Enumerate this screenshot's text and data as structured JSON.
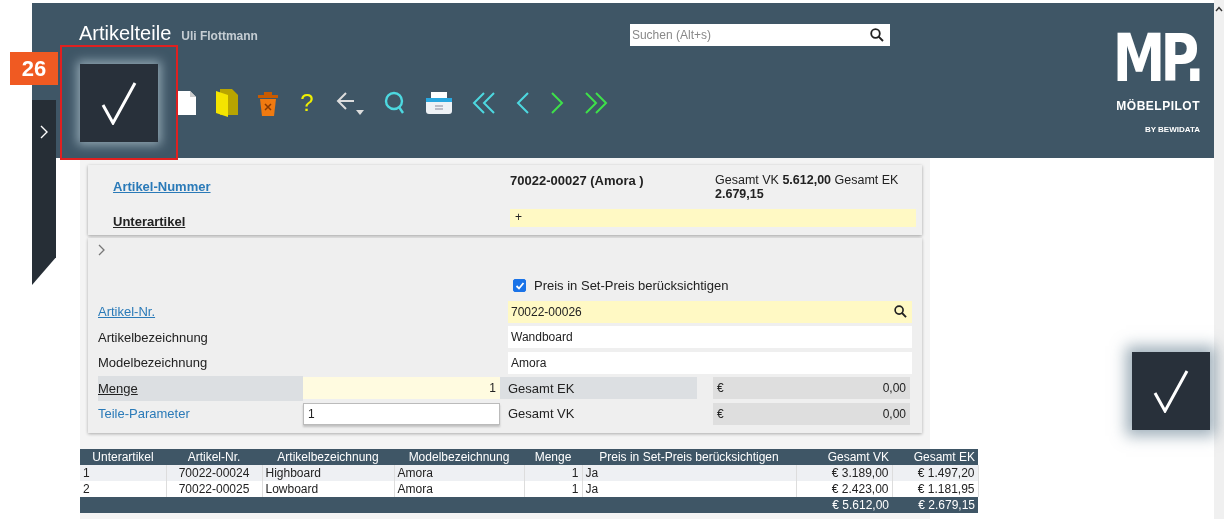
{
  "step_badge": "26",
  "header": {
    "title": "Artikelteile",
    "user": "Uli Flottmann",
    "search": {
      "placeholder": "Suchen (Alt+s)"
    },
    "logo": {
      "wordmark": "MP.",
      "name": "MÖBELPILOT",
      "tagline": "BY BEWIDATA"
    }
  },
  "toolbar": [
    {
      "kind": "confirm"
    },
    {
      "kind": "new"
    },
    {
      "kind": "open"
    },
    {
      "kind": "delete"
    },
    {
      "kind": "help",
      "glyph": "?"
    },
    {
      "kind": "back"
    },
    {
      "kind": "search"
    },
    {
      "kind": "print"
    },
    {
      "kind": "first"
    },
    {
      "kind": "previous"
    },
    {
      "kind": "next"
    },
    {
      "kind": "last"
    }
  ],
  "summary": {
    "number_label": "Artikel-Nummer",
    "number_value": "70022-00027 (Amora )",
    "totals": "Gesamt VK **5.612,00** Gesamt EK **2.679,15**",
    "sub_label": "Unterartikel",
    "sub_value": "+"
  },
  "form": {
    "checkbox": {
      "label": "Preis in Set-Preis berücksichtigen",
      "checked": true
    },
    "rows": [
      {
        "kind": "lookup",
        "label": "Artikel-Nr.",
        "value": "70022-00026"
      },
      {
        "kind": "text",
        "label": "Artikelbezeichnung",
        "value": "Wandboard"
      },
      {
        "kind": "text",
        "label": "Modelbezeichnung",
        "value": "Amora"
      },
      {
        "kind": "amount",
        "label": "Menge",
        "value": "1",
        "total_label": "Gesamt EK",
        "currency": "€",
        "total": "0,00"
      },
      {
        "kind": "select",
        "label": "Teile-Parameter",
        "value": "1",
        "total_label": "Gesamt VK",
        "currency": "€",
        "total": "0,00"
      }
    ]
  },
  "table": {
    "columns": [
      "Unterartikel",
      "Artikel-Nr.",
      "Artikelbezeichnung",
      "Modelbezeichnung",
      "Menge",
      "Preis in Set-Preis berücksichtigen",
      "Gesamt VK",
      "Gesamt EK"
    ],
    "rows": [
      [
        "1",
        "70022-00024",
        "Highboard",
        "Amora",
        "1",
        "Ja",
        "€ 3.189,00",
        "€ 1.497,20"
      ],
      [
        "2",
        "70022-00025",
        "Lowboard",
        "Amora",
        "1",
        "Ja",
        "€ 2.423,00",
        "€ 1.181,95"
      ]
    ],
    "footer": {
      "total_vk": "€ 5.612,00",
      "total_ek": "€ 2.679,15"
    }
  }
}
